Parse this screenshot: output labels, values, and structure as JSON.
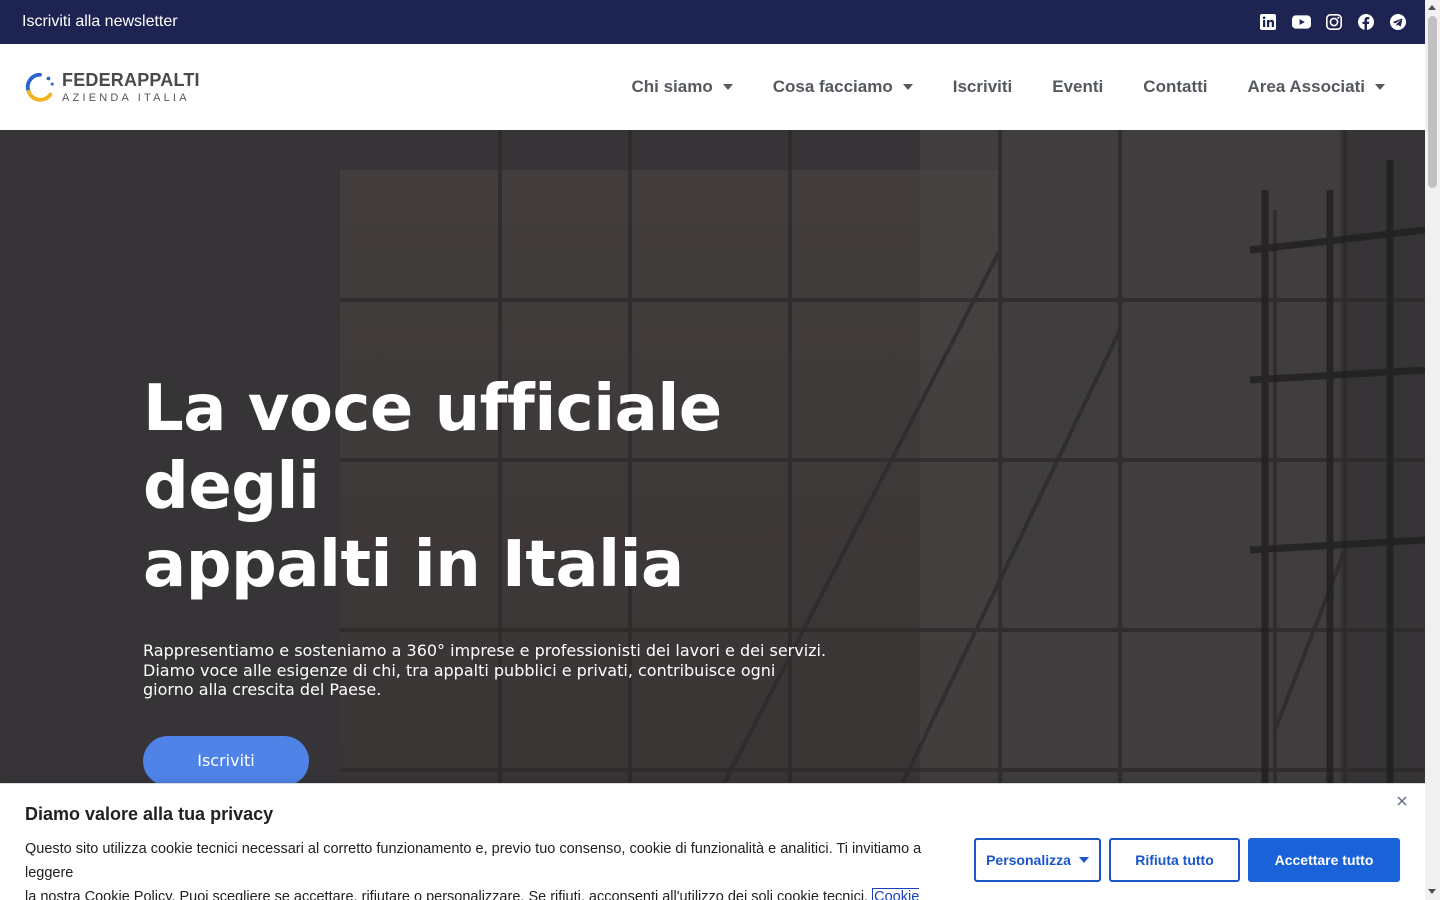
{
  "topbar": {
    "newsletter_link": "Iscriviti alla newsletter",
    "socials": [
      "linkedin-icon",
      "youtube-icon",
      "instagram-icon",
      "facebook-icon",
      "telegram-icon"
    ]
  },
  "header": {
    "logo_name": "FEDERAPPALTI",
    "logo_sub": "AZIENDA ITALIA",
    "nav": [
      {
        "label": "Chi siamo",
        "dropdown": true
      },
      {
        "label": "Cosa facciamo",
        "dropdown": true
      },
      {
        "label": "Iscriviti",
        "dropdown": false
      },
      {
        "label": "Eventi",
        "dropdown": false
      },
      {
        "label": "Contatti",
        "dropdown": false
      },
      {
        "label": "Area Associati",
        "dropdown": true
      }
    ]
  },
  "hero": {
    "title_line1": "La voce ufficiale degli",
    "title_line2": "appalti in Italia",
    "text_line1": "Rappresentiamo e sosteniamo a 360° imprese e professionisti dei lavori e dei servizi.",
    "text_line2": "Diamo voce alle esigenze di chi, tra appalti pubblici e privati, contribuisce ogni",
    "text_line3": "giorno alla crescita del Paese.",
    "cta": "Iscriviti"
  },
  "cookie": {
    "title": "Diamo valore alla tua privacy",
    "text_line1": "Questo sito utilizza cookie tecnici necessari al corretto funzionamento e, previo tuo consenso, cookie di funzionalità e analitici. Ti invitiamo a leggere",
    "text_line2": "la nostra Cookie Policy. Puoi scegliere se accettare, rifiutare o personalizzare. Se rifiuti, acconsenti all'utilizzo dei soli cookie tecnici.",
    "policy_link": "Cookie Policy",
    "customize": "Personalizza",
    "reject": "Rifiuta tutto",
    "accept": "Accettare tutto"
  },
  "colors": {
    "topbar_bg": "#1d2451",
    "cta_bg": "#4f83e8",
    "cookie_accent": "#1a62d9"
  }
}
